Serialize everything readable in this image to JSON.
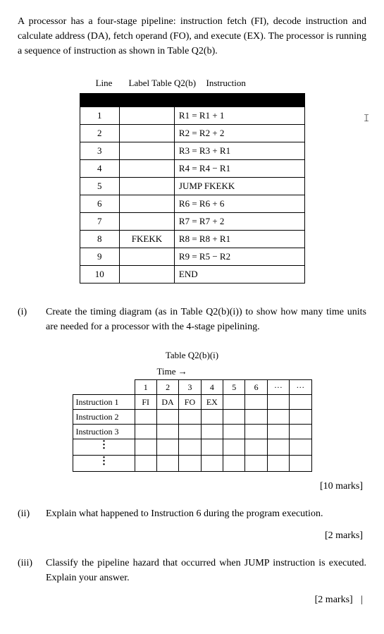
{
  "intro": "A processor has a four-stage pipeline: instruction fetch (FI), decode instruction and calculate address (DA), fetch operand (FO), and execute (EX). The processor is running a sequence of instruction as shown in Table Q2(b).",
  "table1": {
    "headers": {
      "line": "Line",
      "label": "Label  Table Q2(b)",
      "instruction": "Instruction"
    },
    "rows": [
      {
        "line": "1",
        "label": "",
        "instr": "R1 = R1 + 1"
      },
      {
        "line": "2",
        "label": "",
        "instr": "R2 = R2 + 2"
      },
      {
        "line": "3",
        "label": "",
        "instr": "R3 = R3 + R1"
      },
      {
        "line": "4",
        "label": "",
        "instr": "R4 = R4 − R1"
      },
      {
        "line": "5",
        "label": "",
        "instr": "JUMP FKEKK"
      },
      {
        "line": "6",
        "label": "",
        "instr": "R6 = R6 + 6"
      },
      {
        "line": "7",
        "label": "",
        "instr": "R7 = R7 + 2"
      },
      {
        "line": "8",
        "label": "FKEKK",
        "instr": "R8 = R8 + R1"
      },
      {
        "line": "9",
        "label": "",
        "instr": "R9 = R5 − R2"
      },
      {
        "line": "10",
        "label": "",
        "instr": "END"
      }
    ]
  },
  "cursor1": "𝙸",
  "parts": {
    "i": {
      "num": "(i)",
      "text": "Create the timing diagram (as in Table Q2(b)(i)) to show how many time units are needed for a processor with the 4-stage pipelining.",
      "marks": "[10 marks]"
    },
    "ii": {
      "num": "(ii)",
      "text": "Explain what happened to Instruction 6 during the program execution.",
      "marks": "[2 marks]"
    },
    "iii": {
      "num": "(iii)",
      "text": "Classify the pipeline hazard that occurred when JUMP instruction is executed. Explain your answer.",
      "marks": "[2 marks]"
    }
  },
  "table2": {
    "title": "Table Q2(b)(i)",
    "time_label": "Time →",
    "cols": [
      "1",
      "2",
      "3",
      "4",
      "5",
      "6",
      "···",
      "···"
    ],
    "rows": [
      {
        "head": "Instruction 1",
        "cells": [
          "FI",
          "DA",
          "FO",
          "EX",
          "",
          "",
          "",
          ""
        ]
      },
      {
        "head": "Instruction 2",
        "cells": [
          "",
          "",
          "",
          "",
          "",
          "",
          "",
          ""
        ]
      },
      {
        "head": "Instruction 3",
        "cells": [
          "",
          "",
          "",
          "",
          "",
          "",
          "",
          ""
        ]
      },
      {
        "head": "⋮",
        "cells": [
          "",
          "",
          "",
          "",
          "",
          "",
          "",
          ""
        ]
      },
      {
        "head": "⋮",
        "cells": [
          "",
          "",
          "",
          "",
          "",
          "",
          "",
          ""
        ]
      }
    ]
  },
  "cursor2": "|"
}
